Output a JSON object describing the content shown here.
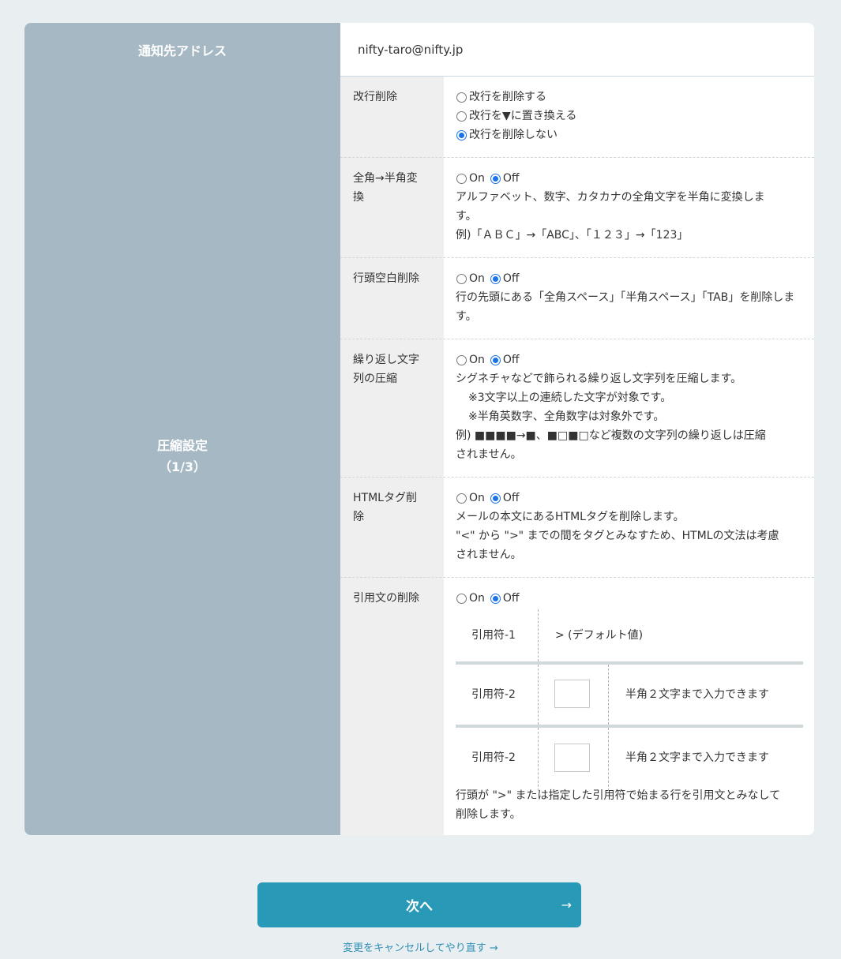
{
  "address": {
    "label": "通知先アドレス",
    "value": "nifty-taro@nifty.jp"
  },
  "compression": {
    "title": "圧縮設定",
    "page": "（1/3）",
    "line_break": {
      "label": "改行削除",
      "options": [
        "改行を削除する",
        "改行を▼に置き換える",
        "改行を削除しない"
      ],
      "selected": 2
    },
    "fullwidth": {
      "label_1": "全角→半角変",
      "label_2": "換",
      "on": "On",
      "off": "Off",
      "desc_1": "アルファベット、数字、カタカナの全角文字を半角に変換しま",
      "desc_2": "す。",
      "desc_3": "例)「ＡＢＣ」→「ABC」、「１２３」→「123」"
    },
    "leading_space": {
      "label": "行頭空白削除",
      "on": "On",
      "off": "Off",
      "desc_1": "行の先頭にある「全角スペース」「半角スペース」「TAB」を削除しま",
      "desc_2": "す。"
    },
    "repeat": {
      "label_1": "繰り返し文字",
      "label_2": "列の圧縮",
      "on": "On",
      "off": "Off",
      "desc_1": "シグネチャなどで飾られる繰り返し文字列を圧縮します。",
      "note_1": "※3文字以上の連続した文字が対象です。",
      "note_2": "※半角英数字、全角数字は対象外です。",
      "desc_2": "例) ■■■■→■、■□■□など複数の文字列の繰り返しは圧縮",
      "desc_3": "されません。"
    },
    "html": {
      "label_1": "HTMLタグ削",
      "label_2": "除",
      "on": "On",
      "off": "Off",
      "desc_1": "メールの本文にあるHTMLタグを削除します。",
      "desc_2": "\"<\" から \">\" までの間をタグとみなすため、HTMLの文法は考慮",
      "desc_3": "されません。"
    },
    "quote": {
      "label": "引用文の削除",
      "on": "On",
      "off": "Off",
      "rows": [
        {
          "label": "引用符-1",
          "value": "> (デフォルト値)"
        },
        {
          "label": "引用符-2",
          "hint": "半角２文字まで入力できます"
        },
        {
          "label": "引用符-2",
          "hint": "半角２文字まで入力できます"
        }
      ],
      "desc_1": "行頭が \">\" または指定した引用符で始まる行を引用文とみなして",
      "desc_2": "削除します。"
    }
  },
  "next_button": {
    "label": "次へ",
    "arrow": "→"
  },
  "cancel_link": "変更をキャンセルしてやり直す →"
}
